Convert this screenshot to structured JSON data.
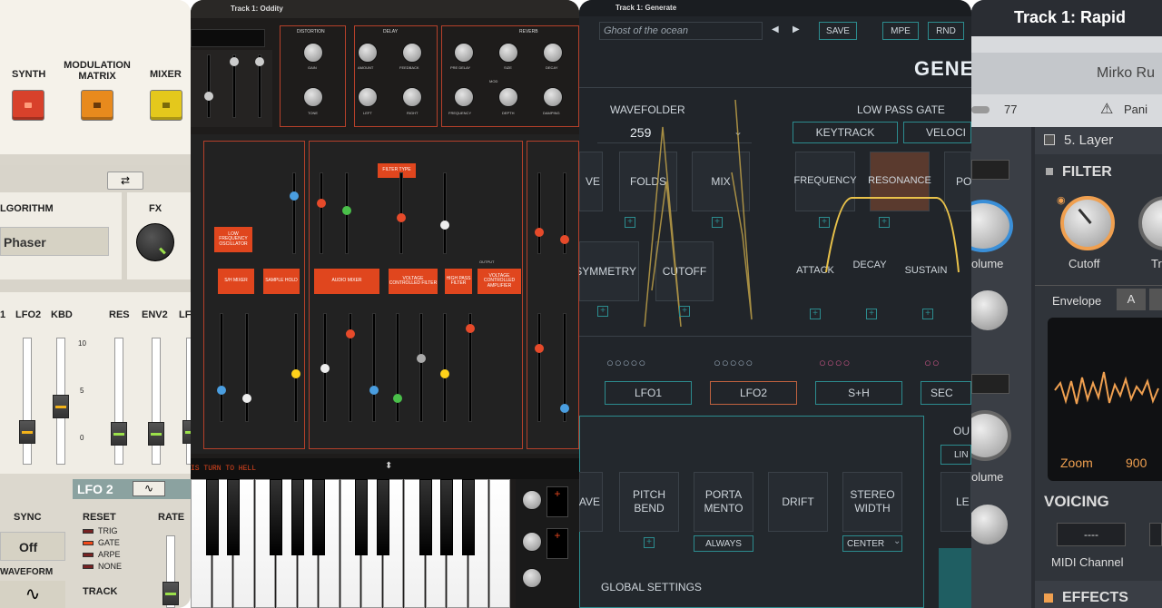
{
  "panel1": {
    "buttons": {
      "synth": "SYNTH",
      "modulation_matrix": "MODULATION\nMATRIX",
      "mixer": "MIXER"
    },
    "algorithm_label": "LGORITHM",
    "fx_label": "FX",
    "algorithm_value": "Phaser",
    "fader_labels": [
      "1",
      "LFO2",
      "KBD",
      "RES",
      "ENV2",
      "LF"
    ],
    "scale": [
      "10",
      "5",
      "0"
    ],
    "lfo_title": "LFO 2",
    "sync_label": "SYNC",
    "sync_value": "Off",
    "waveform_label": "WAVEFORM",
    "reset_label": "RESET",
    "reset_options": [
      "TRIG",
      "GATE",
      "ARPE",
      "NONE"
    ],
    "rate_label": "RATE",
    "track_label": "TRACK",
    "colors": {
      "synth": "#d8412b",
      "mod": "#e88a1d",
      "mixer": "#e4c81c"
    }
  },
  "panel2": {
    "title": "Track 1: Oddity",
    "section_labels": {
      "distortion": "DISTORTION",
      "delay": "DELAY",
      "reverb": "REVERB"
    },
    "knob_labels": [
      "GAIN",
      "TONE",
      "AMOUNT",
      "FEEDBACK",
      "LEFT",
      "RIGHT",
      "PRE DELAY",
      "SIZE",
      "DECAY",
      "FREQUENCY",
      "DEPTH",
      "DAMPING"
    ],
    "mod_label": "MOD",
    "modules": [
      "LOW FREQUENCY OSCILLATOR",
      "S/H MIXER",
      "SAMPLE HOLD",
      "AUDIO MIXER",
      "VOLTAGE CONTROLLED FILTER",
      "HIGH PASS FILTER",
      "VOLTAGE CONTROLLED AMPLIFIER",
      "FILTER TYPE"
    ],
    "output_label": "OUTPUT",
    "preset_name": "IS TURN TO HELL",
    "colors": {
      "accent": "#e0461e"
    }
  },
  "panel3": {
    "title": "Track 1: Generate",
    "preset_name": "Ghost of the ocean",
    "buttons": {
      "save": "SAVE",
      "mpe": "MPE",
      "rnd": "RND"
    },
    "brand": "GENE",
    "wavefolder_label": "WAVEFOLDER",
    "wavefolder_value": "259",
    "lowpass_label": "LOW PASS GATE",
    "keytrack": "KEYTRACK",
    "veloc": "VELOCI",
    "folds": "FOLDS",
    "mix": "MIX",
    "ve": "VE",
    "symmetry": "SYMMETRY",
    "cutoff": "CUTOFF",
    "frequency": "FREQUENCY",
    "resonance": "RESONANCE",
    "po": "PO",
    "attack": "ATTACK",
    "decay": "DECAY",
    "sustain": "SUSTAIN",
    "lfos": [
      "LFO1",
      "LFO2",
      "S+H",
      "SEC"
    ],
    "global_buttons": [
      "AVE",
      "PITCH\nBEND",
      "PORTA\nMENTO",
      "DRIFT",
      "STEREO\nWIDTH"
    ],
    "always": "ALWAYS",
    "center": "CENTER",
    "global_settings": "GLOBAL SETTINGS",
    "out": "OU",
    "lin": "LIN",
    "le": "LE",
    "colors": {
      "accent": "#2c8c8f",
      "envelope": "#e9c24a"
    }
  },
  "panel4": {
    "title": "Track 1: Rapid",
    "author": "Mirko Ru",
    "number": "77",
    "panic": "Pani",
    "layer": "5. Layer",
    "filter": "FILTER",
    "cutoff": "Cutoff",
    "tr": "Tr",
    "volume1": "olume",
    "volume2": "olume",
    "envelope": "Envelope",
    "env_tab": "A",
    "zoom_label": "Zoom",
    "zoom_value": "900",
    "voicing": "VOICING",
    "dash": "----",
    "midi_channel": "MIDI Channel",
    "effects": "EFFECTS",
    "colors": {
      "knob_ring": "#f0a050",
      "blue_ring": "#3a8fd8"
    }
  }
}
